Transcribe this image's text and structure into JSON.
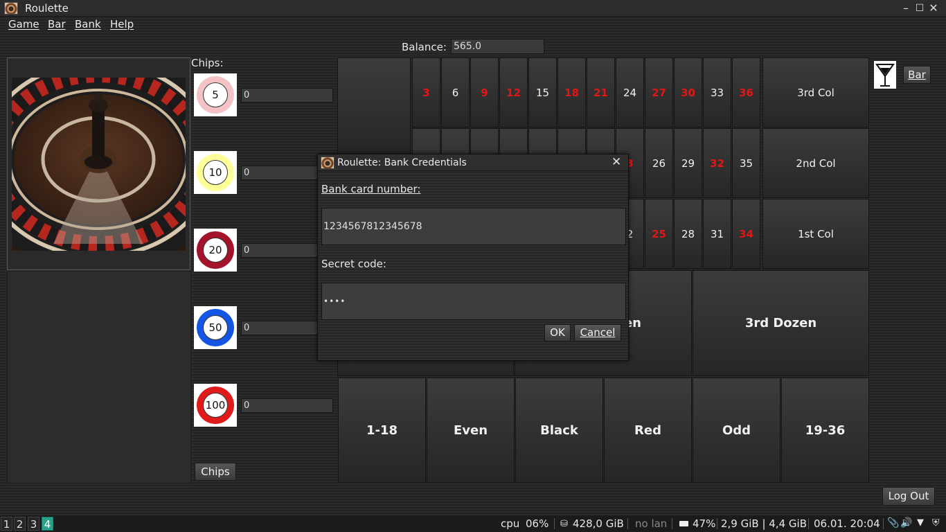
{
  "window": {
    "title": "Roulette"
  },
  "menu": [
    "Game",
    "Bar",
    "Bank",
    "Help"
  ],
  "balance": {
    "label": "Balance:",
    "value": "565.0"
  },
  "chips": {
    "label": "Chips:",
    "items": [
      {
        "value": "5",
        "count": "0",
        "ring_color": "#f4c2c4"
      },
      {
        "value": "10",
        "count": "0",
        "ring_color": "#ffff9a"
      },
      {
        "value": "20",
        "count": "0",
        "ring_color": "#a4122b"
      },
      {
        "value": "50",
        "count": "0",
        "ring_color": "#1455e4"
      },
      {
        "value": "100",
        "count": "0",
        "ring_color": "#e01b1b"
      }
    ],
    "button_label": "Chips"
  },
  "table": {
    "row3": [
      "3",
      "6",
      "9",
      "12",
      "15",
      "18",
      "21",
      "24",
      "27",
      "30",
      "33",
      "36"
    ],
    "row3_red": [
      true,
      false,
      true,
      true,
      false,
      true,
      true,
      false,
      true,
      true,
      false,
      true
    ],
    "row2_visible": [
      "3",
      "26",
      "29",
      "32",
      "35"
    ],
    "row2_red": [
      true,
      false,
      false,
      true,
      false
    ],
    "row1_visible": [
      "2",
      "25",
      "28",
      "31",
      "34"
    ],
    "row1_red": [
      false,
      true,
      false,
      false,
      true
    ],
    "columns": [
      "3rd Col",
      "2nd Col",
      "1st Col"
    ],
    "dozens": [
      "en",
      "3rd Dozen"
    ],
    "outside": [
      "1-18",
      "Even",
      "Black",
      "Red",
      "Odd",
      "19-36"
    ]
  },
  "bar_button": "Bar",
  "logout_button": "Log Out",
  "dialog": {
    "title": "Roulette: Bank Credentials",
    "card_label": "Bank card number:",
    "card_value": "1234567812345678",
    "code_label": "Secret code:",
    "code_value": "••••",
    "ok": "OK",
    "cancel": "Cancel"
  },
  "taskbar": {
    "workspaces": [
      "1",
      "2",
      "3",
      "4"
    ],
    "active_workspace": "4",
    "cpu_label": "cpu",
    "cpu_value": "06%",
    "disk": "428,0 GiB",
    "network": "no lan",
    "battery": "47%",
    "memory": "2,9 GiB | 4,4 GiB",
    "datetime": "06.01. 20:04"
  },
  "colors": {
    "red_number": "#e51515",
    "active_workspace": "#2aa18a"
  }
}
